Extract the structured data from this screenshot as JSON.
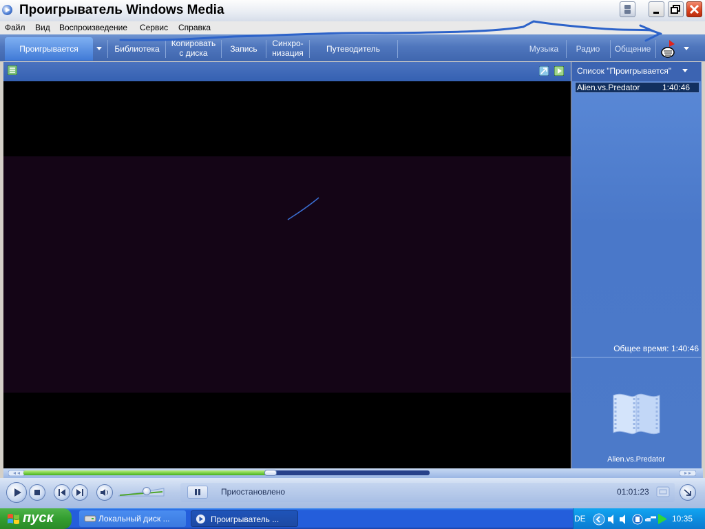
{
  "window": {
    "title": "Проигрыватель Windows Media"
  },
  "menu": [
    "Файл",
    "Вид",
    "Воспроизведение",
    "Сервис",
    "Справка"
  ],
  "nav_tabs": {
    "now_playing": "Проигрывается",
    "library": "Библиотека",
    "rip_line1": "Копировать",
    "rip_line2": "с диска",
    "burn": "Запись",
    "sync_line1": "Синхро-",
    "sync_line2": "низация",
    "guide": "Путеводитель",
    "music": "Музыка",
    "radio": "Радио",
    "community": "Общение"
  },
  "playlist": {
    "header": "Список \"Проигрывается\"",
    "items": [
      {
        "title": "Alien.vs.Predator",
        "duration": "1:40:46"
      }
    ],
    "total_time": "Общее время: 1:40:46",
    "album_label": "Alien.vs.Predator"
  },
  "playback": {
    "status": "Приостановлено",
    "time": "01:01:23",
    "progress": 0.6
  },
  "taskbar": {
    "start_label": "пуск",
    "tasks": [
      "Локальный диск ...",
      "Проигрыватель ..."
    ],
    "language": "DE",
    "clock": "10:35"
  },
  "colors": {
    "accent": "#4f76bd",
    "video_bg": "#140516",
    "seek_fill": "#46b01e",
    "start_green": "#339e30"
  },
  "icons": [
    "wmp-logo-icon",
    "restore-icon",
    "minimize-icon",
    "maximize-icon",
    "close-icon",
    "play-icon",
    "stop-icon",
    "prev-icon",
    "next-icon",
    "mute-icon",
    "pause-icon",
    "minimode-icon",
    "fullscreen-icon",
    "filmstrip-icon",
    "speaker-icon",
    "shopping-hand-icon"
  ]
}
